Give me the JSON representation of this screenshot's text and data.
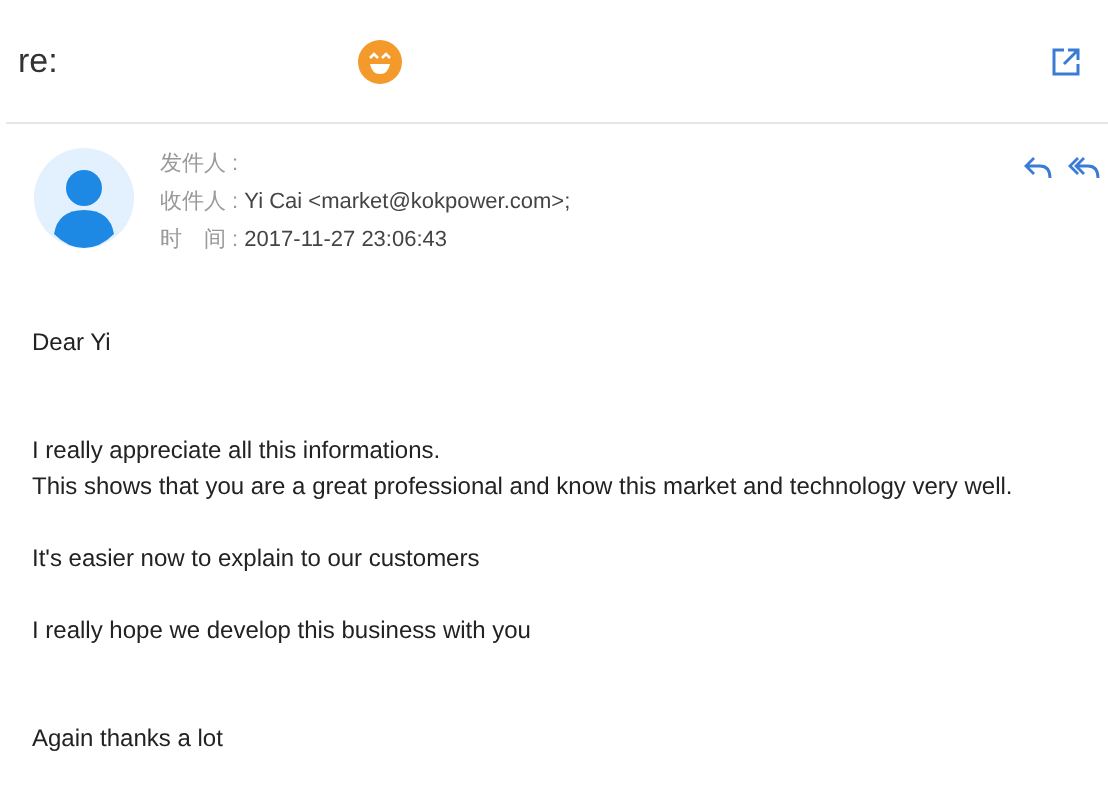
{
  "subject": "re:",
  "meta": [
    {
      "label": "发件人 :"
    },
    {
      "label": "收件人 :",
      "value": "Yi Cai <market@kokpower.com>;"
    },
    {
      "label": "时　间 :",
      "value": "2017-11-27 23:06:43"
    }
  ],
  "body": [
    {
      "kind": "line",
      "text": "Dear Yi"
    },
    {
      "kind": "gap"
    },
    {
      "kind": "gap"
    },
    {
      "kind": "line",
      "text": "I really appreciate all this informations."
    },
    {
      "kind": "line",
      "text": "This shows that you are a great professional and know this market and technology very well."
    },
    {
      "kind": "gap"
    },
    {
      "kind": "line",
      "text": "It's easier now to explain to our customers"
    },
    {
      "kind": "gap"
    },
    {
      "kind": "line",
      "text": "I really hope we develop this business with you"
    },
    {
      "kind": "gap"
    },
    {
      "kind": "gap"
    },
    {
      "kind": "line",
      "text": "Again thanks a lot"
    }
  ]
}
